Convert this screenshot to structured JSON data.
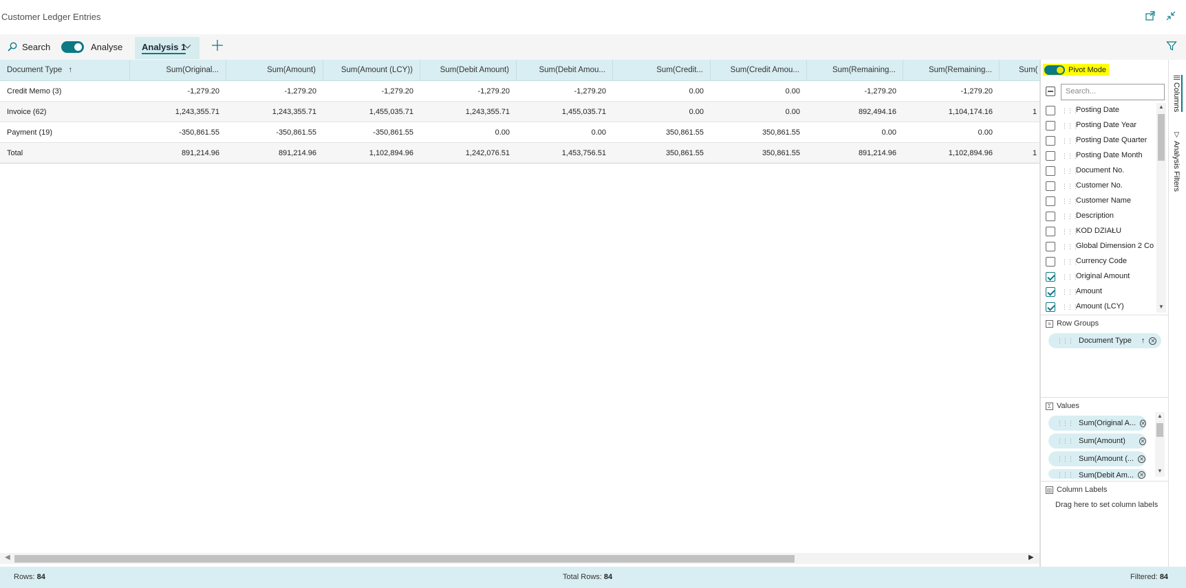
{
  "window": {
    "title": "Customer Ledger Entries"
  },
  "toolbar": {
    "search_label": "Search",
    "analyse_label": "Analyse",
    "tab_label": "Analysis 1"
  },
  "grid": {
    "headers": [
      "Document Type",
      "Sum(Original...",
      "Sum(Amount)",
      "Sum(Amount (LCY))",
      "Sum(Debit Amount)",
      "Sum(Debit Amou...",
      "Sum(Credit...",
      "Sum(Credit Amou...",
      "Sum(Remaining...",
      "Sum(Remaining...",
      "Sum("
    ],
    "rows": [
      [
        "Credit Memo (3)",
        "-1,279.20",
        "-1,279.20",
        "-1,279.20",
        "-1,279.20",
        "-1,279.20",
        "0.00",
        "0.00",
        "-1,279.20",
        "-1,279.20",
        ""
      ],
      [
        "Invoice (62)",
        "1,243,355.71",
        "1,243,355.71",
        "1,455,035.71",
        "1,243,355.71",
        "1,455,035.71",
        "0.00",
        "0.00",
        "892,494.16",
        "1,104,174.16",
        "1"
      ],
      [
        "Payment (19)",
        "-350,861.55",
        "-350,861.55",
        "-350,861.55",
        "0.00",
        "0.00",
        "350,861.55",
        "350,861.55",
        "0.00",
        "0.00",
        ""
      ],
      [
        "Total",
        "891,214.96",
        "891,214.96",
        "1,102,894.96",
        "1,242,076.51",
        "1,453,756.51",
        "350,861.55",
        "350,861.55",
        "891,214.96",
        "1,102,894.96",
        "1"
      ]
    ]
  },
  "sidepanel": {
    "pivot_label": "Pivot Mode",
    "search_placeholder": "Search...",
    "columns": [
      {
        "name": "Posting Date",
        "checked": false
      },
      {
        "name": "Posting Date Year",
        "checked": false
      },
      {
        "name": "Posting Date Quarter",
        "checked": false
      },
      {
        "name": "Posting Date Month",
        "checked": false
      },
      {
        "name": "Document No.",
        "checked": false
      },
      {
        "name": "Customer No.",
        "checked": false
      },
      {
        "name": "Customer Name",
        "checked": false
      },
      {
        "name": "Description",
        "checked": false
      },
      {
        "name": "KOD DZIAŁU",
        "checked": false
      },
      {
        "name": "Global Dimension 2 Co",
        "checked": false
      },
      {
        "name": "Currency Code",
        "checked": false
      },
      {
        "name": "Original Amount",
        "checked": true
      },
      {
        "name": "Amount",
        "checked": true
      },
      {
        "name": "Amount (LCY)",
        "checked": true
      }
    ],
    "row_groups_label": "Row Groups",
    "row_group_pill": "Document Type",
    "values_label": "Values",
    "values": [
      "Sum(Original A...",
      "Sum(Amount)",
      "Sum(Amount (...",
      "Sum(Debit Am..."
    ],
    "column_labels_label": "Column Labels",
    "column_labels_hint": "Drag here to set column labels"
  },
  "side_tabs": {
    "columns": "Columns",
    "filters": "Analysis Filters"
  },
  "footer": {
    "rows_label": "Rows:",
    "rows_value": "84",
    "total_label": "Total Rows:",
    "total_value": "84",
    "filtered_label": "Filtered:",
    "filtered_value": "84"
  },
  "colors": {
    "accent": "#0b7a85",
    "header_bg": "#d9eef2",
    "highlight": "#ffff00"
  }
}
